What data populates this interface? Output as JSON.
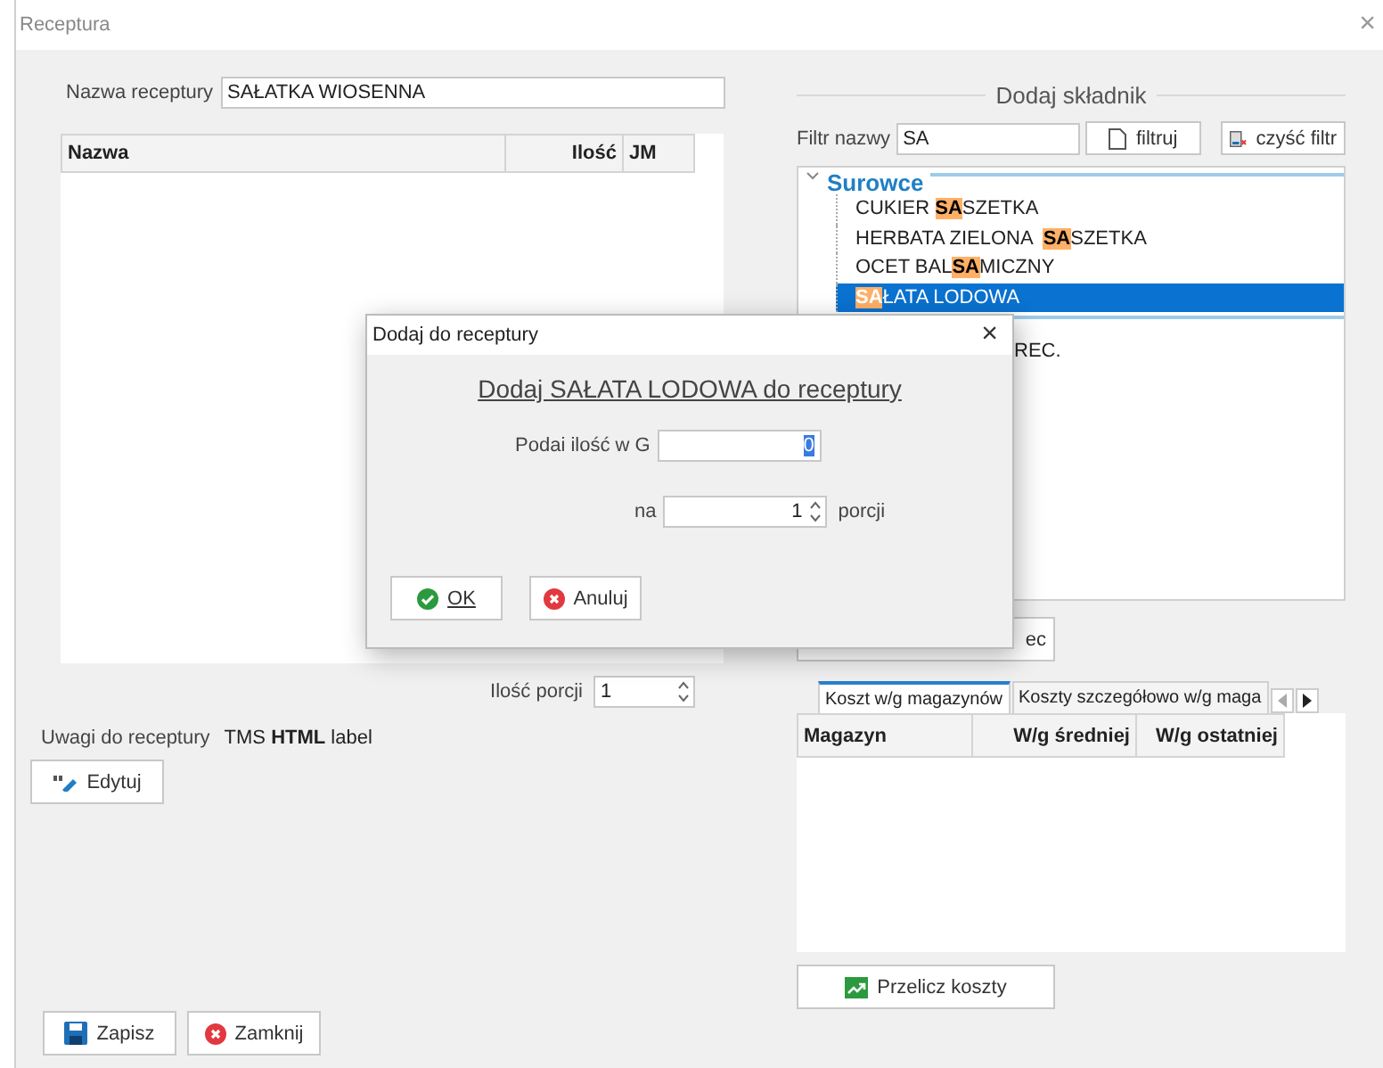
{
  "window": {
    "title": "Receptura",
    "close": "×"
  },
  "recipe_name": {
    "label": "Nazwa receptury",
    "value": "SAŁATKA WIOSENNA"
  },
  "ingredients_table": {
    "columns": [
      "Nazwa",
      "Ilość",
      "JM"
    ]
  },
  "portions": {
    "label": "Ilość porcji",
    "value": "1"
  },
  "notes": {
    "label": "Uwagi do receptury",
    "value": "TMS **HTML** label"
  },
  "edit_button": "Edytuj",
  "save_button": "Zapisz",
  "close_button": "Zamknij",
  "add_ingredient": {
    "title": "Dodaj składnik",
    "filter_label": "Filtr nazwy",
    "filter_value": "SA",
    "filter_button": "filtruj",
    "clear_button": "czyść filtr",
    "tree": [
      {
        "label": "Surowce",
        "expanded": true,
        "items": [
          {
            "before": "CUKIER ",
            "match": "SA",
            "after": "SZETKA",
            "selected": false
          },
          {
            "before": "HERBATA ZIELONA  ",
            "match": "SA",
            "after": "SZETKA",
            "selected": false
          },
          {
            "before": "OCET BAL",
            "match": "SA",
            "after": "MICZNY",
            "selected": false
          },
          {
            "match": "SA",
            "after": "ŁATA LODOWA",
            "selected": true
          }
        ]
      },
      {
        "items": [
          {
            "before": "REC.",
            "selected": false
          }
        ]
      }
    ],
    "add_button": "ec"
  },
  "cost_tabs": [
    {
      "label": "Koszt w/g magazynów",
      "selected": true
    },
    {
      "label": "Koszty szczegółowo w/g maga",
      "selected": false
    }
  ],
  "cost_table": {
    "columns": [
      "Magazyn",
      "W/g średniej",
      "W/g ostatniej"
    ]
  },
  "recalc_button": "Przelicz koszty",
  "dialog": {
    "title": "Dodaj do receptury",
    "close": "×",
    "heading": "Dodaj SAŁATA LODOWA do receptury",
    "quantity_label": "Podai ilość w G",
    "quantity_value": "0",
    "per_label": "na",
    "per_value": "1",
    "per_unit": "porcji",
    "ok": "OK",
    "cancel": "Anuluj"
  }
}
